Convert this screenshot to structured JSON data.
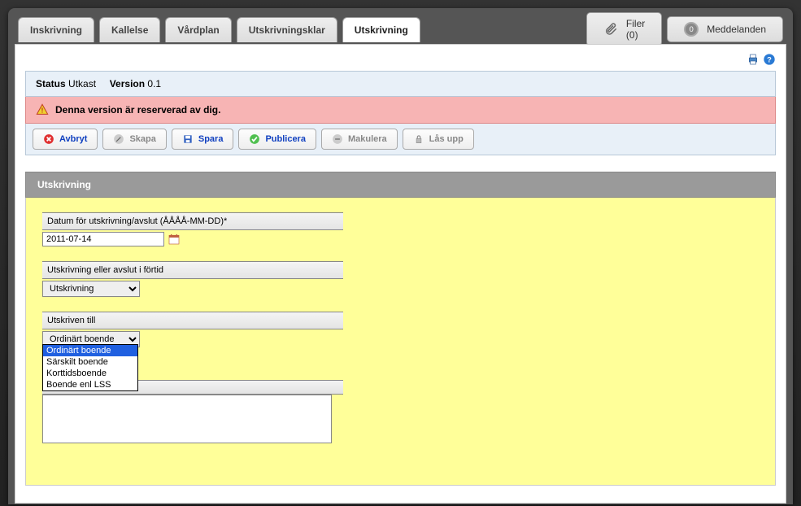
{
  "tabs": {
    "inskrivning": "Inskrivning",
    "kallelse": "Kallelse",
    "vardplan": "Vårdplan",
    "utskrivningsklar": "Utskrivningsklar",
    "utskrivning": "Utskrivning"
  },
  "topButtons": {
    "filer": "Filer (0)",
    "meddelanden": "Meddelanden",
    "meddBadge": "0"
  },
  "status": {
    "statusLabel": "Status",
    "statusValue": "Utkast",
    "versionLabel": "Version",
    "versionValue": "0.1"
  },
  "alert": "Denna version är reserverad av dig.",
  "toolbar": {
    "avbryt": "Avbryt",
    "skapa": "Skapa",
    "spara": "Spara",
    "publicera": "Publicera",
    "makulera": "Makulera",
    "lasupp": "Lås upp"
  },
  "sectionTitle": "Utskrivning",
  "fields": {
    "datumLabel": "Datum för utskrivning/avslut (ÅÅÅÅ-MM-DD)*",
    "datumValue": "2011-07-14",
    "avslutLabel": "Utskrivning eller avslut i förtid",
    "avslutValue": "Utskrivning",
    "tillLabel": "Utskriven till",
    "tillValue": "Ordinärt boende",
    "tillOptions": {
      "o1": "Ordinärt boende",
      "o2": "Särskilt boende",
      "o3": "Korttidsboende",
      "o4": "Boende enl LSS"
    }
  }
}
